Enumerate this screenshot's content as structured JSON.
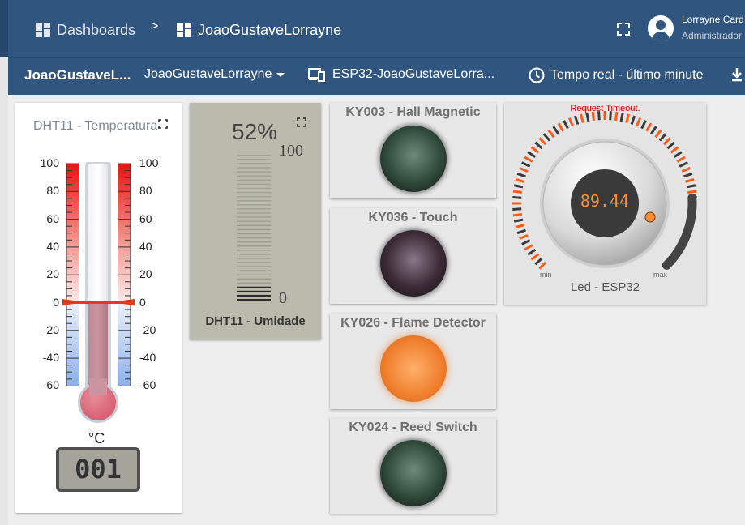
{
  "header": {
    "breadcrumb": {
      "dashboards": "Dashboards",
      "separator": ">",
      "current": "JoaoGustaveLorrayne"
    },
    "user": {
      "name": "Lorrayne Card",
      "role": "Administrador"
    }
  },
  "toolbar": {
    "title": "JoaoGustaveL...",
    "entity": "JoaoGustaveLorrayne",
    "device": "ESP32-JoaoGustaveLorra...",
    "timewindow": "Tempo real - último minute"
  },
  "widgets": {
    "temperature": {
      "title": "DHT11 - Temperatura",
      "scale": [
        "100",
        "80",
        "60",
        "40",
        "20",
        "0",
        "-20",
        "-40",
        "-60"
      ],
      "unit": "°C",
      "lcd": "001"
    },
    "humidity": {
      "value": "52%",
      "max": "100",
      "min": "0",
      "label": "DHT11 - Umidade",
      "level": 0.52
    },
    "leds": [
      {
        "title": "KY003 - Hall Magnetic",
        "state": "off",
        "color": "#2f4a3a"
      },
      {
        "title": "KY036 - Touch",
        "state": "off",
        "color": "#3b2a36"
      },
      {
        "title": "KY026 - Flame Detector",
        "state": "on",
        "color": "#f07f2d"
      },
      {
        "title": "KY024 - Reed Switch",
        "state": "off",
        "color": "#2f4a3a"
      }
    ],
    "knob": {
      "error": "Request Timeout.",
      "value": "89.44",
      "min_label": "min",
      "max_label": "max",
      "label": "Led - ESP32"
    }
  },
  "colors": {
    "header": "#305680",
    "accent": "#ff6a1a",
    "error": "#d40000"
  }
}
